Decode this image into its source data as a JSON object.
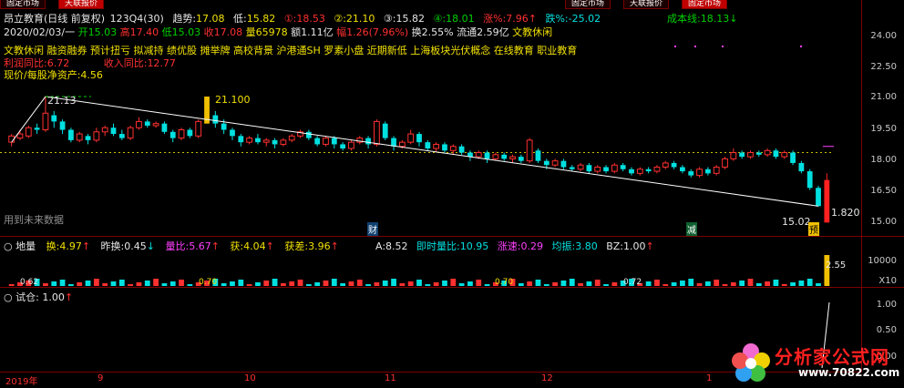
{
  "tabs": [
    "固定市场",
    "天联报价",
    "固定市场",
    "天联报价",
    "固定市场"
  ],
  "header": {
    "title": "昂立教育(日线 前复权)",
    "period_code": "123Q4(30)",
    "trend_label": "趋势:",
    "trend_value": "17.08",
    "low_label": "低:",
    "low_value": "15.82",
    "c1_label": "①:",
    "c1_value": "18.53",
    "c2_label": "②:",
    "c2_value": "21.10",
    "c3_label": "③:",
    "c3_value": "15.82",
    "c4_label": "④:",
    "c4_value": "18.01",
    "rise_label": "涨%:",
    "rise_value": "7.96",
    "drop_label": "跌%:",
    "drop_value": "-25.02",
    "cost_label": "成本线:",
    "cost_value": "18.13"
  },
  "quote": {
    "date": "2020/02/03/一",
    "open": "开15.03",
    "high": "高17.40",
    "low": "低15.03",
    "close": "收17.08",
    "volume": "量65978",
    "amount": "额1.11亿",
    "amp": "幅1.26(7.96%)",
    "turnover": "换2.55%",
    "float": "流通2.59亿",
    "sector": "文教休闲"
  },
  "concepts": "文教休闲 融资融券 预计扭亏 拟减持 绩优股 摊举牌 高校背景 沪港通SH 罗素小盘 近期新低 上海板块光伏概念 在线教育 职业教育",
  "fundamentals": {
    "profit_label": "利润同比:",
    "profit_value": "6.72",
    "revenue_label": "收入同比:",
    "revenue_value": "12.77",
    "nav_label": "现价/每股净资产:",
    "nav_value": "4.56"
  },
  "chart_annotations": {
    "peak": "21.13",
    "peak_val2": "21.100",
    "low": "15.02",
    "last": "1.820",
    "future_hint": "用到未来数据",
    "marker_cai": "财",
    "marker_jian": "减",
    "marker_yu": "预"
  },
  "chart_data": {
    "type": "candlestick",
    "yticks": [
      "24.00",
      "22.50",
      "21.00",
      "19.50",
      "18.00",
      "16.50",
      "15.00"
    ],
    "ylim": [
      15.0,
      24.0
    ],
    "x_labels": [
      "2019年",
      "9",
      "10",
      "11",
      "12",
      "1"
    ],
    "candles": [
      {
        "o": 18.9,
        "c": 19.2,
        "h": 19.3,
        "l": 18.7
      },
      {
        "o": 19.1,
        "c": 19.3,
        "h": 19.5,
        "l": 19.0
      },
      {
        "o": 19.2,
        "c": 19.6,
        "h": 19.7,
        "l": 19.1
      },
      {
        "o": 19.6,
        "c": 19.5,
        "h": 19.8,
        "l": 19.3
      },
      {
        "o": 19.5,
        "c": 20.3,
        "h": 21.13,
        "l": 19.4
      },
      {
        "o": 20.2,
        "c": 19.9,
        "h": 20.4,
        "l": 19.6
      },
      {
        "o": 19.9,
        "c": 19.5,
        "h": 20.0,
        "l": 19.3
      },
      {
        "o": 19.5,
        "c": 19.0,
        "h": 19.6,
        "l": 18.9
      },
      {
        "o": 19.0,
        "c": 19.3,
        "h": 19.4,
        "l": 18.9
      },
      {
        "o": 19.2,
        "c": 19.0,
        "h": 19.3,
        "l": 18.8
      },
      {
        "o": 19.0,
        "c": 19.4,
        "h": 19.6,
        "l": 18.9
      },
      {
        "o": 19.4,
        "c": 19.6,
        "h": 19.7,
        "l": 19.2
      },
      {
        "o": 19.6,
        "c": 19.3,
        "h": 19.8,
        "l": 19.2
      },
      {
        "o": 19.3,
        "c": 19.1,
        "h": 19.5,
        "l": 19.0
      },
      {
        "o": 19.1,
        "c": 19.6,
        "h": 19.7,
        "l": 19.0
      },
      {
        "o": 19.6,
        "c": 19.9,
        "h": 20.1,
        "l": 19.5
      },
      {
        "o": 19.9,
        "c": 19.7,
        "h": 20.0,
        "l": 19.6
      },
      {
        "o": 19.7,
        "c": 19.8,
        "h": 19.9,
        "l": 19.6
      },
      {
        "o": 19.8,
        "c": 19.4,
        "h": 19.9,
        "l": 19.3
      },
      {
        "o": 19.4,
        "c": 19.1,
        "h": 19.5,
        "l": 18.9
      },
      {
        "o": 19.1,
        "c": 19.5,
        "h": 19.6,
        "l": 19.0
      },
      {
        "o": 19.5,
        "c": 19.2,
        "h": 19.6,
        "l": 19.1
      },
      {
        "o": 19.2,
        "c": 19.9,
        "h": 20.0,
        "l": 19.1
      },
      {
        "o": 19.8,
        "c": 21.1,
        "h": 21.1,
        "l": 19.8
      },
      {
        "o": 20.2,
        "c": 19.8,
        "h": 20.4,
        "l": 19.6
      },
      {
        "o": 19.8,
        "c": 19.5,
        "h": 20.0,
        "l": 19.3
      },
      {
        "o": 19.5,
        "c": 19.2,
        "h": 19.6,
        "l": 19.0
      },
      {
        "o": 19.2,
        "c": 18.9,
        "h": 19.3,
        "l": 18.7
      },
      {
        "o": 18.9,
        "c": 19.1,
        "h": 19.2,
        "l": 18.8
      },
      {
        "o": 19.1,
        "c": 18.9,
        "h": 19.3,
        "l": 18.8
      },
      {
        "o": 18.9,
        "c": 19.0,
        "h": 19.1,
        "l": 18.7
      },
      {
        "o": 19.0,
        "c": 18.8,
        "h": 19.1,
        "l": 18.6
      },
      {
        "o": 18.8,
        "c": 19.0,
        "h": 19.1,
        "l": 18.7
      },
      {
        "o": 19.0,
        "c": 19.2,
        "h": 19.3,
        "l": 18.9
      },
      {
        "o": 19.2,
        "c": 19.4,
        "h": 19.5,
        "l": 19.1
      },
      {
        "o": 19.4,
        "c": 19.1,
        "h": 19.5,
        "l": 19.0
      },
      {
        "o": 19.1,
        "c": 18.8,
        "h": 19.2,
        "l": 18.7
      },
      {
        "o": 18.8,
        "c": 19.1,
        "h": 19.2,
        "l": 18.7
      },
      {
        "o": 19.1,
        "c": 18.8,
        "h": 19.2,
        "l": 18.6
      },
      {
        "o": 18.8,
        "c": 18.6,
        "h": 18.9,
        "l": 18.5
      },
      {
        "o": 18.6,
        "c": 18.9,
        "h": 19.0,
        "l": 18.5
      },
      {
        "o": 18.9,
        "c": 19.1,
        "h": 19.2,
        "l": 18.8
      },
      {
        "o": 19.1,
        "c": 18.8,
        "h": 19.2,
        "l": 18.6
      },
      {
        "o": 18.8,
        "c": 19.9,
        "h": 20.0,
        "l": 18.7
      },
      {
        "o": 19.8,
        "c": 19.1,
        "h": 19.9,
        "l": 19.0
      },
      {
        "o": 19.1,
        "c": 18.7,
        "h": 19.2,
        "l": 18.5
      },
      {
        "o": 18.7,
        "c": 18.9,
        "h": 19.0,
        "l": 18.6
      },
      {
        "o": 18.9,
        "c": 19.3,
        "h": 19.5,
        "l": 18.8
      },
      {
        "o": 19.3,
        "c": 18.9,
        "h": 19.4,
        "l": 18.7
      },
      {
        "o": 18.9,
        "c": 18.6,
        "h": 19.0,
        "l": 18.5
      },
      {
        "o": 18.6,
        "c": 18.8,
        "h": 18.9,
        "l": 18.4
      },
      {
        "o": 18.8,
        "c": 18.5,
        "h": 18.9,
        "l": 18.4
      },
      {
        "o": 18.5,
        "c": 18.7,
        "h": 18.8,
        "l": 18.3
      },
      {
        "o": 18.7,
        "c": 18.4,
        "h": 18.8,
        "l": 18.3
      },
      {
        "o": 18.4,
        "c": 18.2,
        "h": 18.5,
        "l": 18.0
      },
      {
        "o": 18.2,
        "c": 18.4,
        "h": 18.5,
        "l": 18.1
      },
      {
        "o": 18.4,
        "c": 18.1,
        "h": 18.5,
        "l": 17.9
      },
      {
        "o": 18.1,
        "c": 18.3,
        "h": 18.4,
        "l": 18.0
      },
      {
        "o": 18.3,
        "c": 18.1,
        "h": 18.4,
        "l": 18.0
      },
      {
        "o": 18.1,
        "c": 18.2,
        "h": 18.3,
        "l": 17.9
      },
      {
        "o": 18.2,
        "c": 18.0,
        "h": 18.3,
        "l": 17.9
      },
      {
        "o": 18.0,
        "c": 19.0,
        "h": 19.1,
        "l": 17.9
      },
      {
        "o": 18.5,
        "c": 18.0,
        "h": 18.6,
        "l": 17.9
      },
      {
        "o": 18.0,
        "c": 17.8,
        "h": 18.1,
        "l": 17.6
      },
      {
        "o": 17.8,
        "c": 18.0,
        "h": 18.1,
        "l": 17.7
      },
      {
        "o": 18.0,
        "c": 17.7,
        "h": 18.1,
        "l": 17.6
      },
      {
        "o": 17.7,
        "c": 17.6,
        "h": 17.8,
        "l": 17.5
      },
      {
        "o": 17.6,
        "c": 17.8,
        "h": 17.9,
        "l": 17.5
      },
      {
        "o": 17.8,
        "c": 17.5,
        "h": 17.9,
        "l": 17.4
      },
      {
        "o": 17.5,
        "c": 17.7,
        "h": 17.8,
        "l": 17.4
      },
      {
        "o": 17.7,
        "c": 17.5,
        "h": 17.8,
        "l": 17.4
      },
      {
        "o": 17.5,
        "c": 17.8,
        "h": 17.9,
        "l": 17.4
      },
      {
        "o": 17.8,
        "c": 17.6,
        "h": 17.9,
        "l": 17.5
      },
      {
        "o": 17.6,
        "c": 17.4,
        "h": 17.7,
        "l": 17.3
      },
      {
        "o": 17.4,
        "c": 17.6,
        "h": 17.7,
        "l": 17.3
      },
      {
        "o": 17.6,
        "c": 17.5,
        "h": 17.7,
        "l": 17.4
      },
      {
        "o": 17.5,
        "c": 17.7,
        "h": 17.8,
        "l": 17.4
      },
      {
        "o": 17.7,
        "c": 17.9,
        "h": 18.0,
        "l": 17.6
      },
      {
        "o": 17.9,
        "c": 17.7,
        "h": 18.0,
        "l": 17.6
      },
      {
        "o": 17.7,
        "c": 17.5,
        "h": 17.8,
        "l": 17.4
      },
      {
        "o": 17.5,
        "c": 17.3,
        "h": 17.6,
        "l": 17.2
      },
      {
        "o": 17.3,
        "c": 17.6,
        "h": 17.7,
        "l": 17.2
      },
      {
        "o": 17.6,
        "c": 17.4,
        "h": 17.7,
        "l": 17.3
      },
      {
        "o": 17.4,
        "c": 17.7,
        "h": 17.8,
        "l": 17.3
      },
      {
        "o": 17.7,
        "c": 18.1,
        "h": 18.2,
        "l": 17.6
      },
      {
        "o": 18.1,
        "c": 18.4,
        "h": 18.6,
        "l": 18.0
      },
      {
        "o": 18.4,
        "c": 18.2,
        "h": 18.5,
        "l": 18.1
      },
      {
        "o": 18.2,
        "c": 18.4,
        "h": 18.5,
        "l": 18.1
      },
      {
        "o": 18.4,
        "c": 18.3,
        "h": 18.5,
        "l": 18.2
      },
      {
        "o": 18.3,
        "c": 18.5,
        "h": 18.6,
        "l": 18.2
      },
      {
        "o": 18.5,
        "c": 18.2,
        "h": 18.6,
        "l": 18.1
      },
      {
        "o": 18.2,
        "c": 18.4,
        "h": 18.5,
        "l": 18.1
      },
      {
        "o": 18.4,
        "c": 17.9,
        "h": 18.5,
        "l": 17.8
      },
      {
        "o": 17.9,
        "c": 17.5,
        "h": 18.0,
        "l": 17.4
      },
      {
        "o": 17.5,
        "c": 16.7,
        "h": 17.6,
        "l": 16.6
      },
      {
        "o": 16.7,
        "c": 15.82,
        "h": 16.8,
        "l": 15.8
      },
      {
        "o": 15.03,
        "c": 17.08,
        "h": 17.4,
        "l": 15.03
      }
    ]
  },
  "subchart1": {
    "name": "地量",
    "huan_label": "换:",
    "huan_value": "4.97",
    "zuohuan_label": "昨换:",
    "zuohuan_value": "0.45",
    "liangbi_label": "量比:",
    "liangbi_value": "5.67",
    "huo_label": "获:",
    "huo_value": "4.04",
    "huocha_label": "获差:",
    "huocha_value": "3.96",
    "a_label": "A:",
    "a_value": "8.52",
    "jishi_label": "即时量比:",
    "jishi_value": "10.95",
    "zhangsu_label": "涨速:",
    "zhangsu_value": "0.29",
    "junzhen_label": "均振:",
    "junzhen_value": "3.80",
    "bz_label": "BZ:",
    "bz_value": "1.00",
    "ytick": "10000",
    "ymult": "X10",
    "peak_label": "2.55",
    "bar_labels": [
      "0.62",
      "0.70",
      "0.70",
      "0.72"
    ]
  },
  "subchart2": {
    "name": "试仓",
    "value_label": ":",
    "value": "1.00",
    "yticks": [
      "1.00",
      "0.50",
      "0.00"
    ]
  },
  "watermark": {
    "text": "分析家公式网",
    "url": "www.70822.com"
  }
}
